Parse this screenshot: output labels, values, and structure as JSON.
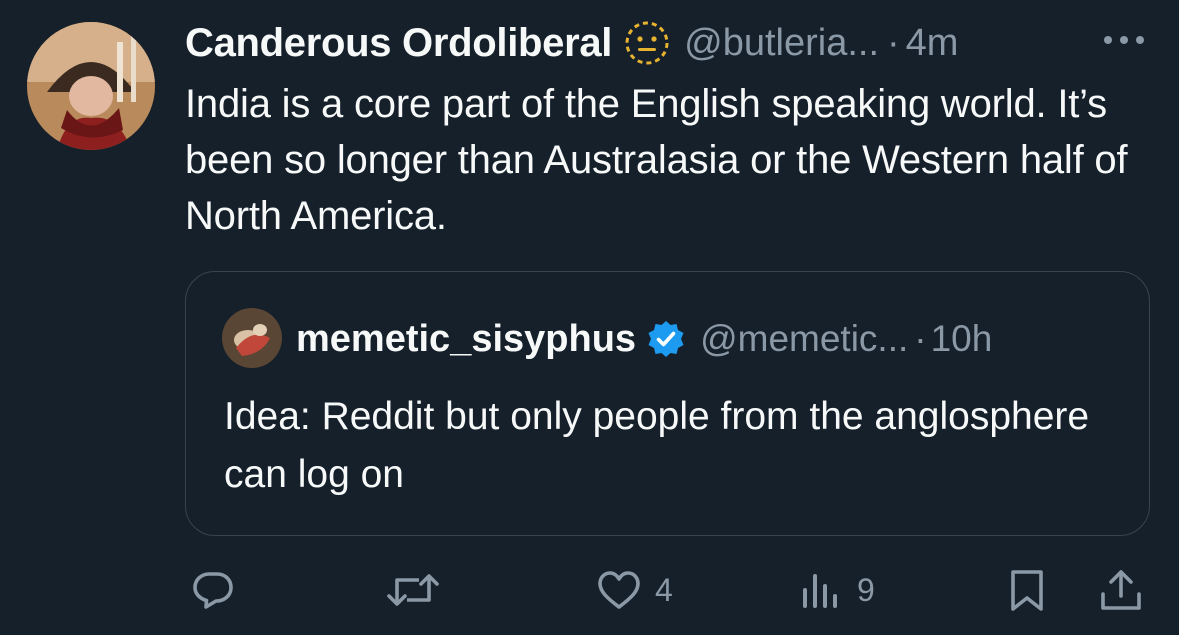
{
  "tweet": {
    "display_name": "Canderous Ordoliberal",
    "name_badge_icon": "neutral-face-emoji-icon",
    "handle": "@butleria...",
    "separator": "·",
    "time": "4m",
    "text": "India is a core part of the English speaking world. It’s been so longer than Australasia or the Western half of North America."
  },
  "quote": {
    "display_name": "memetic_sisyphus",
    "verified_icon": "verified-badge-icon",
    "handle": "@memetic...",
    "separator": "·",
    "time": "10h",
    "text": "Idea: Reddit but only people from the anglosphere can log on"
  },
  "actions": {
    "reply_icon": "reply-icon",
    "retweet_icon": "retweet-icon",
    "like_icon": "heart-icon",
    "like_count": "4",
    "views_icon": "views-chart-icon",
    "views_count": "9",
    "bookmark_icon": "bookmark-icon",
    "share_icon": "share-icon"
  },
  "colors": {
    "background": "#15202b",
    "text_primary": "#f7f9f9",
    "text_secondary": "#8b98a5",
    "border": "#38444d",
    "verified_blue": "#1d9bf0",
    "emoji_gold": "#e8b32f"
  }
}
